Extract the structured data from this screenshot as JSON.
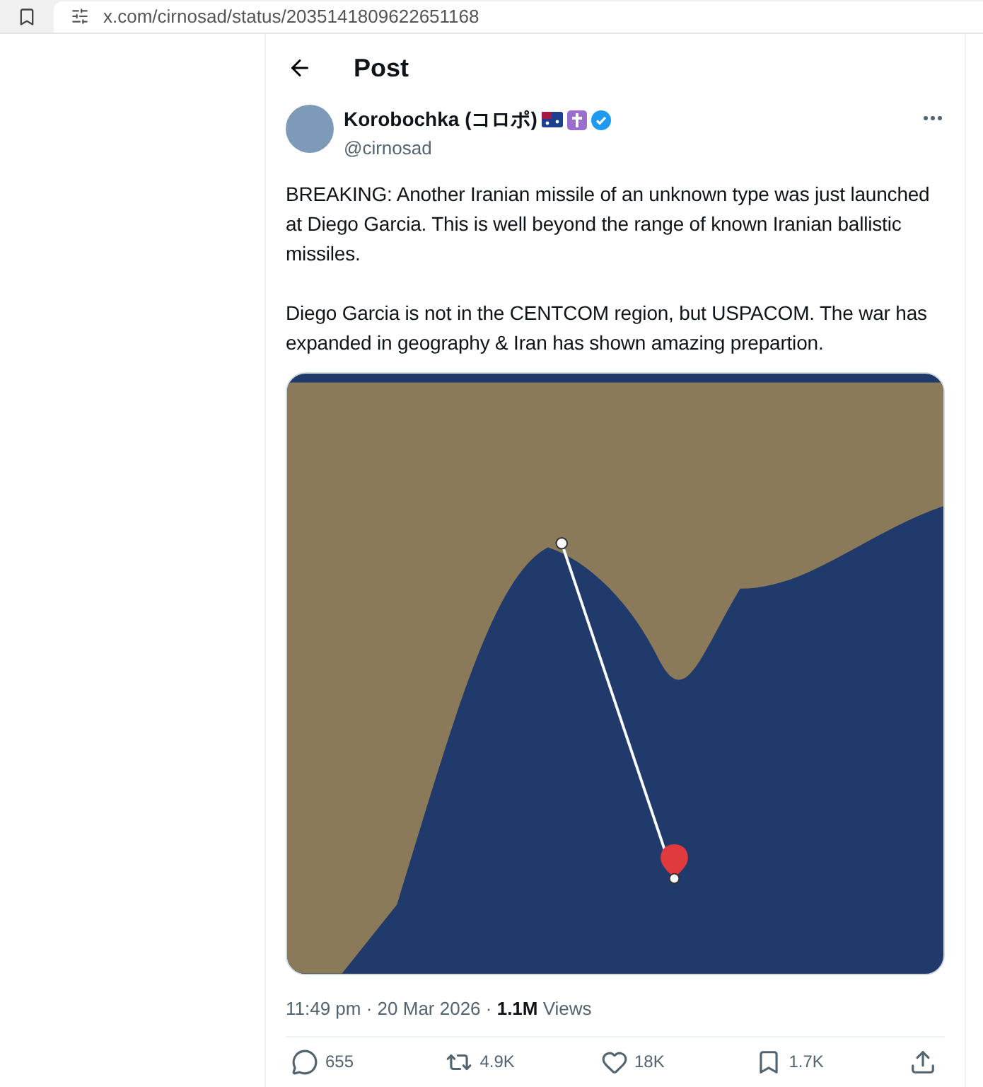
{
  "browser": {
    "url": "x.com/cirnosad/status/2035141809622651168"
  },
  "header": {
    "title": "Post"
  },
  "author": {
    "name": "Korobochka (コロポ)",
    "handle": "@cirnosad",
    "verified": true
  },
  "post": {
    "paragraphs": [
      "BREAKING: Another Iranian missile of an unknown type was just launched at Diego Garcia. This is well beyond the range of known Iranian ballistic missiles.",
      "Diego Garcia is not in the CENTCOM region, but USPACOM. The war has expanded in geography & Iran has shown amazing prepartion."
    ],
    "meta": "11:49 pm · 20 Mar 2026 · **1.1M** Views"
  },
  "actions": [
    {
      "kind": "reply",
      "count": "655"
    },
    {
      "kind": "repost",
      "count": "4.9K"
    },
    {
      "kind": "like",
      "count": "18K"
    },
    {
      "kind": "bookmark",
      "count": "1.7K"
    },
    {
      "kind": "share"
    }
  ]
}
